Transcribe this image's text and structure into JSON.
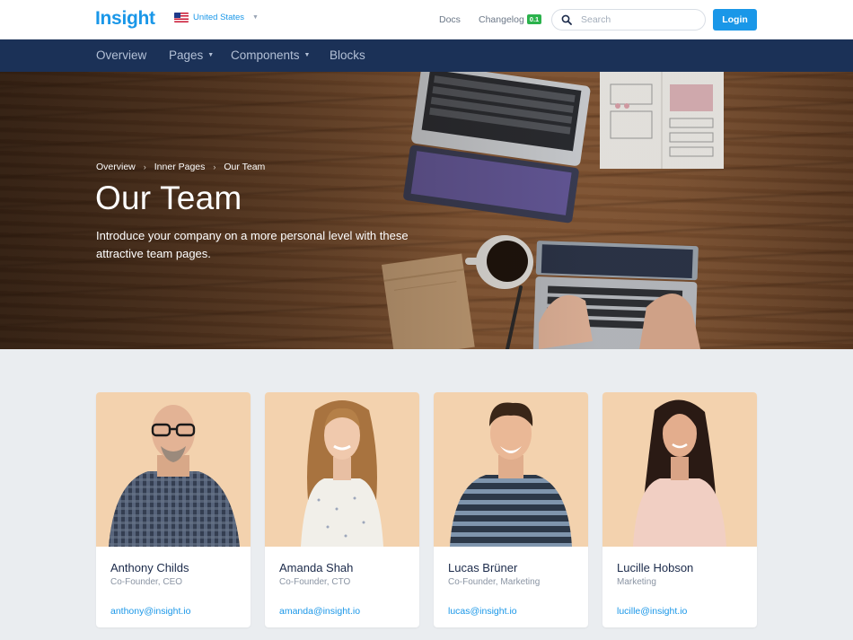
{
  "brand": {
    "logo": "Insight",
    "accent": "#1a97e8",
    "nav_bg": "#1b3157"
  },
  "locale": {
    "label": "United States",
    "flag_icon": "us-flag-icon"
  },
  "topbar": {
    "docs": "Docs",
    "changelog": "Changelog",
    "changelog_badge": "0.1",
    "search_placeholder": "Search",
    "login": "Login"
  },
  "mainnav": {
    "items": [
      {
        "label": "Overview",
        "dropdown": false
      },
      {
        "label": "Pages",
        "dropdown": true
      },
      {
        "label": "Components",
        "dropdown": true
      },
      {
        "label": "Blocks",
        "dropdown": false
      }
    ]
  },
  "hero": {
    "breadcrumb": [
      "Overview",
      "Inner Pages",
      "Our Team"
    ],
    "title": "Our Team",
    "subtitle": "Introduce your company on a more personal level with these attractive team pages."
  },
  "team": [
    {
      "name": "Anthony Childs",
      "role": "Co-Founder, CEO",
      "email": "anthony@insight.io"
    },
    {
      "name": "Amanda Shah",
      "role": "Co-Founder, CTO",
      "email": "amanda@insight.io"
    },
    {
      "name": "Lucas Brüner",
      "role": "Co-Founder, Marketing",
      "email": "lucas@insight.io"
    },
    {
      "name": "Lucille Hobson",
      "role": "Marketing",
      "email": "lucille@insight.io"
    }
  ]
}
